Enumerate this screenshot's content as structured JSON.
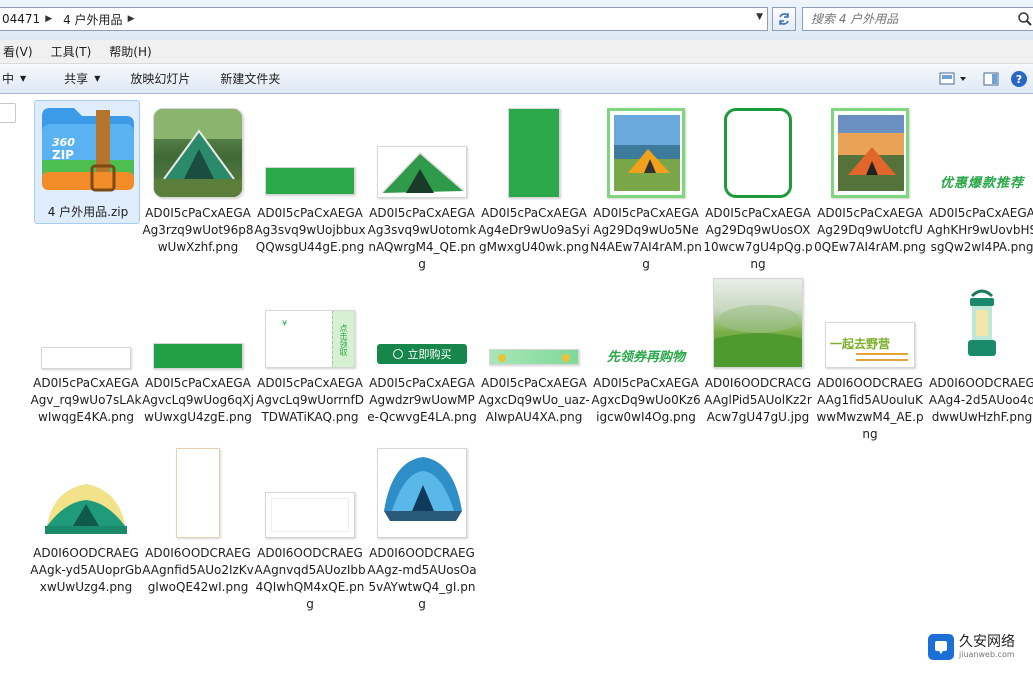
{
  "address": {
    "crumbs": [
      "04471",
      "4 户外用品"
    ],
    "search_placeholder": "搜索 4 户外用品"
  },
  "menu": [
    "看(V)",
    "工具(T)",
    "帮助(H)"
  ],
  "toolbar": {
    "organize_label": "中",
    "share_label": "共享",
    "slideshow_label": "放映幻灯片",
    "new_folder_label": "新建文件夹"
  },
  "files": [
    {
      "name": "4 户外用品.zip",
      "icon": "zip-archive-icon"
    },
    {
      "name": "AD0I5cPaCxAEGAAg3rzq9wUot96p8wUwXzhf.png",
      "icon": "tent-photo"
    },
    {
      "name": "AD0I5cPaCxAEGAAg3svq9wUojbbuxQQwsgU44gE.png",
      "icon": "green-bar"
    },
    {
      "name": "AD0I5cPaCxAEGAAg3svq9wUotomknAQwrgM4_QE.png",
      "icon": "green-tent"
    },
    {
      "name": "AD0I5cPaCxAEGAAg4eDr9wUo9aSyigMwxgU40wk.png",
      "icon": "green-rectangle"
    },
    {
      "name": "AD0I5cPaCxAEGAAg29Dq9wUo5NeN4AEw7AI4rAM.png",
      "icon": "tent-lake-photo"
    },
    {
      "name": "AD0I5cPaCxAEGAAg29Dq9wUosOX10wcw7gU4pQg.png",
      "icon": "green-frame"
    },
    {
      "name": "AD0I5cPaCxAEGAAg29Dq9wUotcfU0QEw7AI4rAM.png",
      "icon": "tent-sunset-photo"
    },
    {
      "name": "AD0I5cPaCxAEGAAghKHr9wUovbHSsgQw2wI4PA.png",
      "icon": "promo-text",
      "thumb_text": "优惠爆款推荐"
    },
    {
      "name": "AD0I5cPaCxAEGAAgv_rq9wUo7sLAkwIwqgE4KA.png",
      "icon": "thin-bar"
    },
    {
      "name": "AD0I5cPaCxAEGAAgvcLq9wUog6qXjwUwxgU4zgE.png",
      "icon": "green-bar-dark"
    },
    {
      "name": "AD0I5cPaCxAEGAAgvcLq9wUorrnfDTDWATiKAQ.png",
      "icon": "coupon",
      "thumb_text": "点击领取"
    },
    {
      "name": "AD0I5cPaCxAEGAAgwdzr9wUowMPe-QcwvgE4LA.png",
      "icon": "buy-button",
      "thumb_text": "立即购买"
    },
    {
      "name": "AD0I5cPaCxAEGAAgxcDq9wUo_uaz-AIwpAU4XA.png",
      "icon": "mint-banner"
    },
    {
      "name": "AD0I5cPaCxAEGAAgxcDq9wUo0Kz6igcw0wI4Og.png",
      "icon": "coupon-text",
      "thumb_text": "先领券再购物"
    },
    {
      "name": "AD0I6OODCRACGAAglPid5AUolKz2rAcw7gU47gU.jpg",
      "icon": "grass-photo"
    },
    {
      "name": "AD0I6OODCRAEGAAg1fid5AUouIuKwwMwzwM4_AE.png",
      "icon": "picnic-logo",
      "thumb_text": "一起去野营"
    },
    {
      "name": "AD0I6OODCRAEGAAg4-2d5AUoo4qdwwUwHzhF.png",
      "icon": "lantern"
    },
    {
      "name": "AD0I6OODCRAEGAAgk-yd5AUoprGbxwUwUzg4.png",
      "icon": "yellow-tent"
    },
    {
      "name": "AD0I6OODCRAEGAAgnfid5AUo2IzKvgIwoQE42wI.png",
      "icon": "tall-frame"
    },
    {
      "name": "AD0I6OODCRAEGAAgnvqd5AUozIbb4QIwhQM4xQE.png",
      "icon": "white-panel"
    },
    {
      "name": "AD0I6OODCRAEGAAgz-md5AUosOa5vAYwtwQ4_gI.png",
      "icon": "blue-tent"
    }
  ],
  "watermark": {
    "cn": "久安网络",
    "en": "jiuanweb.com"
  }
}
